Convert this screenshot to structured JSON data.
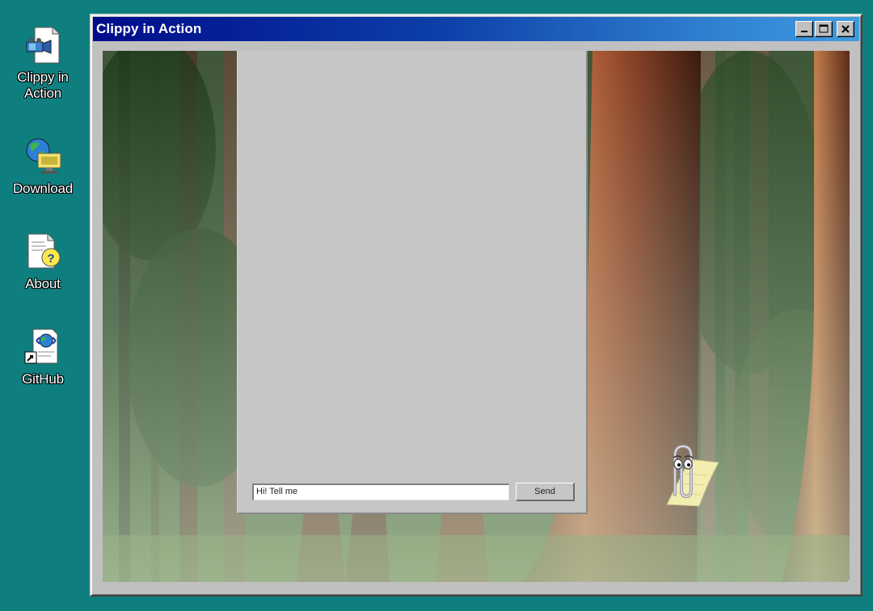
{
  "desktop": {
    "icons": [
      {
        "label": "Clippy in Action",
        "icon": "video-file-icon"
      },
      {
        "label": "Download",
        "icon": "network-globe-icon"
      },
      {
        "label": "About",
        "icon": "help-document-icon"
      },
      {
        "label": "GitHub",
        "icon": "web-shortcut-icon"
      }
    ],
    "background_color": "#0f7e7e"
  },
  "window": {
    "title": "Clippy in Action",
    "controls": [
      "minimize",
      "maximize",
      "close"
    ],
    "titlebar_colors": [
      "#000c8a",
      "#3f9be0"
    ]
  },
  "chat": {
    "input_value": "Hi! Tell me",
    "send_label": "Send"
  },
  "assistant": {
    "icon": "clippy-paperclip-icon"
  }
}
